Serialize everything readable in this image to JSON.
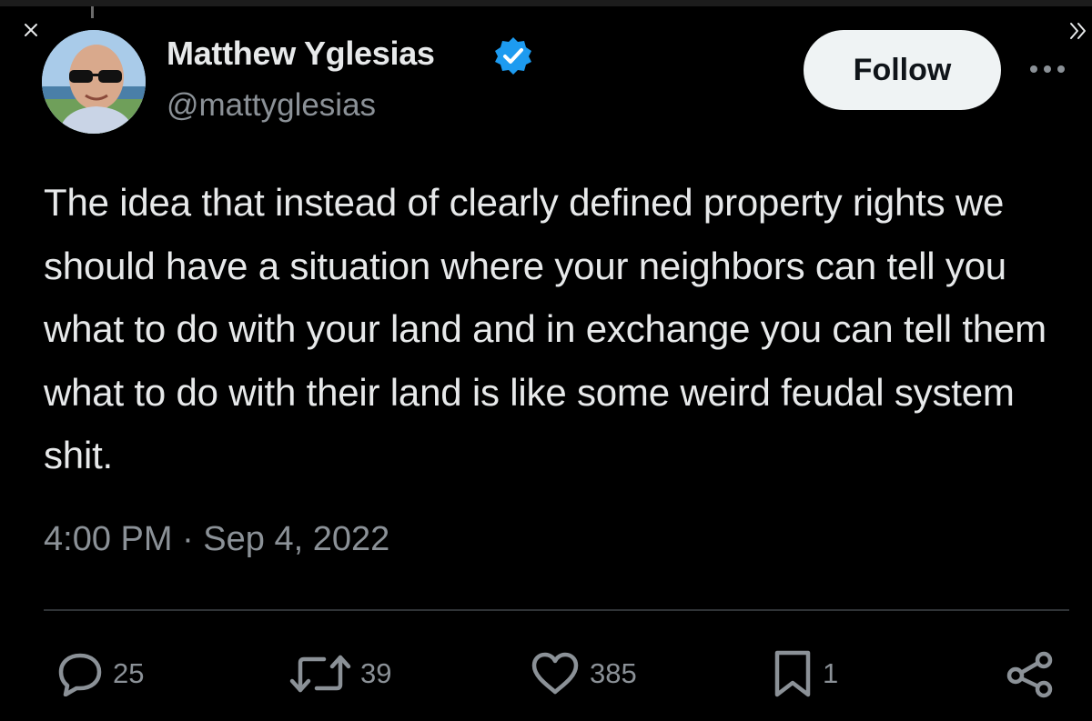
{
  "tweet": {
    "author": {
      "display_name": "Matthew Yglesias",
      "handle": "@mattyglesias",
      "verified": true
    },
    "follow_label": "Follow",
    "text": "The idea that instead of clearly defined property rights we should have a situation where your neighbors can tell you what to do with your land and in exchange you can tell them what to do with their land is like some weird feudal system shit.",
    "timestamp": "4:00 PM · Sep 4, 2022",
    "stats": {
      "replies": "25",
      "retweets": "39",
      "likes": "385",
      "bookmarks": "1"
    }
  },
  "colors": {
    "background": "#000000",
    "text": "#e7e9ea",
    "secondary_text": "#8b9197",
    "verified_badge": "#1d9bf0",
    "follow_button_bg": "#eff3f4"
  },
  "icons": [
    "close-icon",
    "expand-icon",
    "verified-badge-icon",
    "more-icon",
    "reply-icon",
    "retweet-icon",
    "like-icon",
    "bookmark-icon",
    "share-icon"
  ]
}
